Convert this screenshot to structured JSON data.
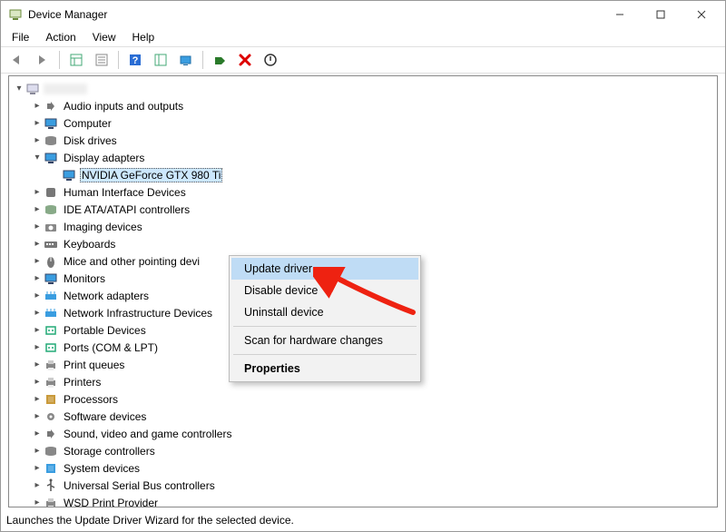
{
  "window": {
    "title": "Device Manager"
  },
  "menubar": {
    "file": "File",
    "action": "Action",
    "view": "View",
    "help": "Help"
  },
  "tree": {
    "root": "",
    "items": [
      {
        "label": "Audio inputs and outputs"
      },
      {
        "label": "Computer"
      },
      {
        "label": "Disk drives"
      },
      {
        "label": "Display adapters",
        "expanded": true
      },
      {
        "label": "NVIDIA GeForce GTX 980 Ti",
        "depth": 2,
        "selected": true,
        "noexpander": true
      },
      {
        "label": "Human Interface Devices"
      },
      {
        "label": "IDE ATA/ATAPI controllers"
      },
      {
        "label": "Imaging devices"
      },
      {
        "label": "Keyboards"
      },
      {
        "label": "Mice and other pointing devi"
      },
      {
        "label": "Monitors"
      },
      {
        "label": "Network adapters"
      },
      {
        "label": "Network Infrastructure Devices"
      },
      {
        "label": "Portable Devices"
      },
      {
        "label": "Ports (COM & LPT)"
      },
      {
        "label": "Print queues"
      },
      {
        "label": "Printers"
      },
      {
        "label": "Processors"
      },
      {
        "label": "Software devices"
      },
      {
        "label": "Sound, video and game controllers"
      },
      {
        "label": "Storage controllers"
      },
      {
        "label": "System devices"
      },
      {
        "label": "Universal Serial Bus controllers"
      },
      {
        "label": "WSD Print Provider"
      }
    ]
  },
  "context_menu": {
    "update": "Update driver",
    "disable": "Disable device",
    "uninstall": "Uninstall device",
    "scan": "Scan for hardware changes",
    "properties": "Properties"
  },
  "statusbar": {
    "text": "Launches the Update Driver Wizard for the selected device."
  }
}
